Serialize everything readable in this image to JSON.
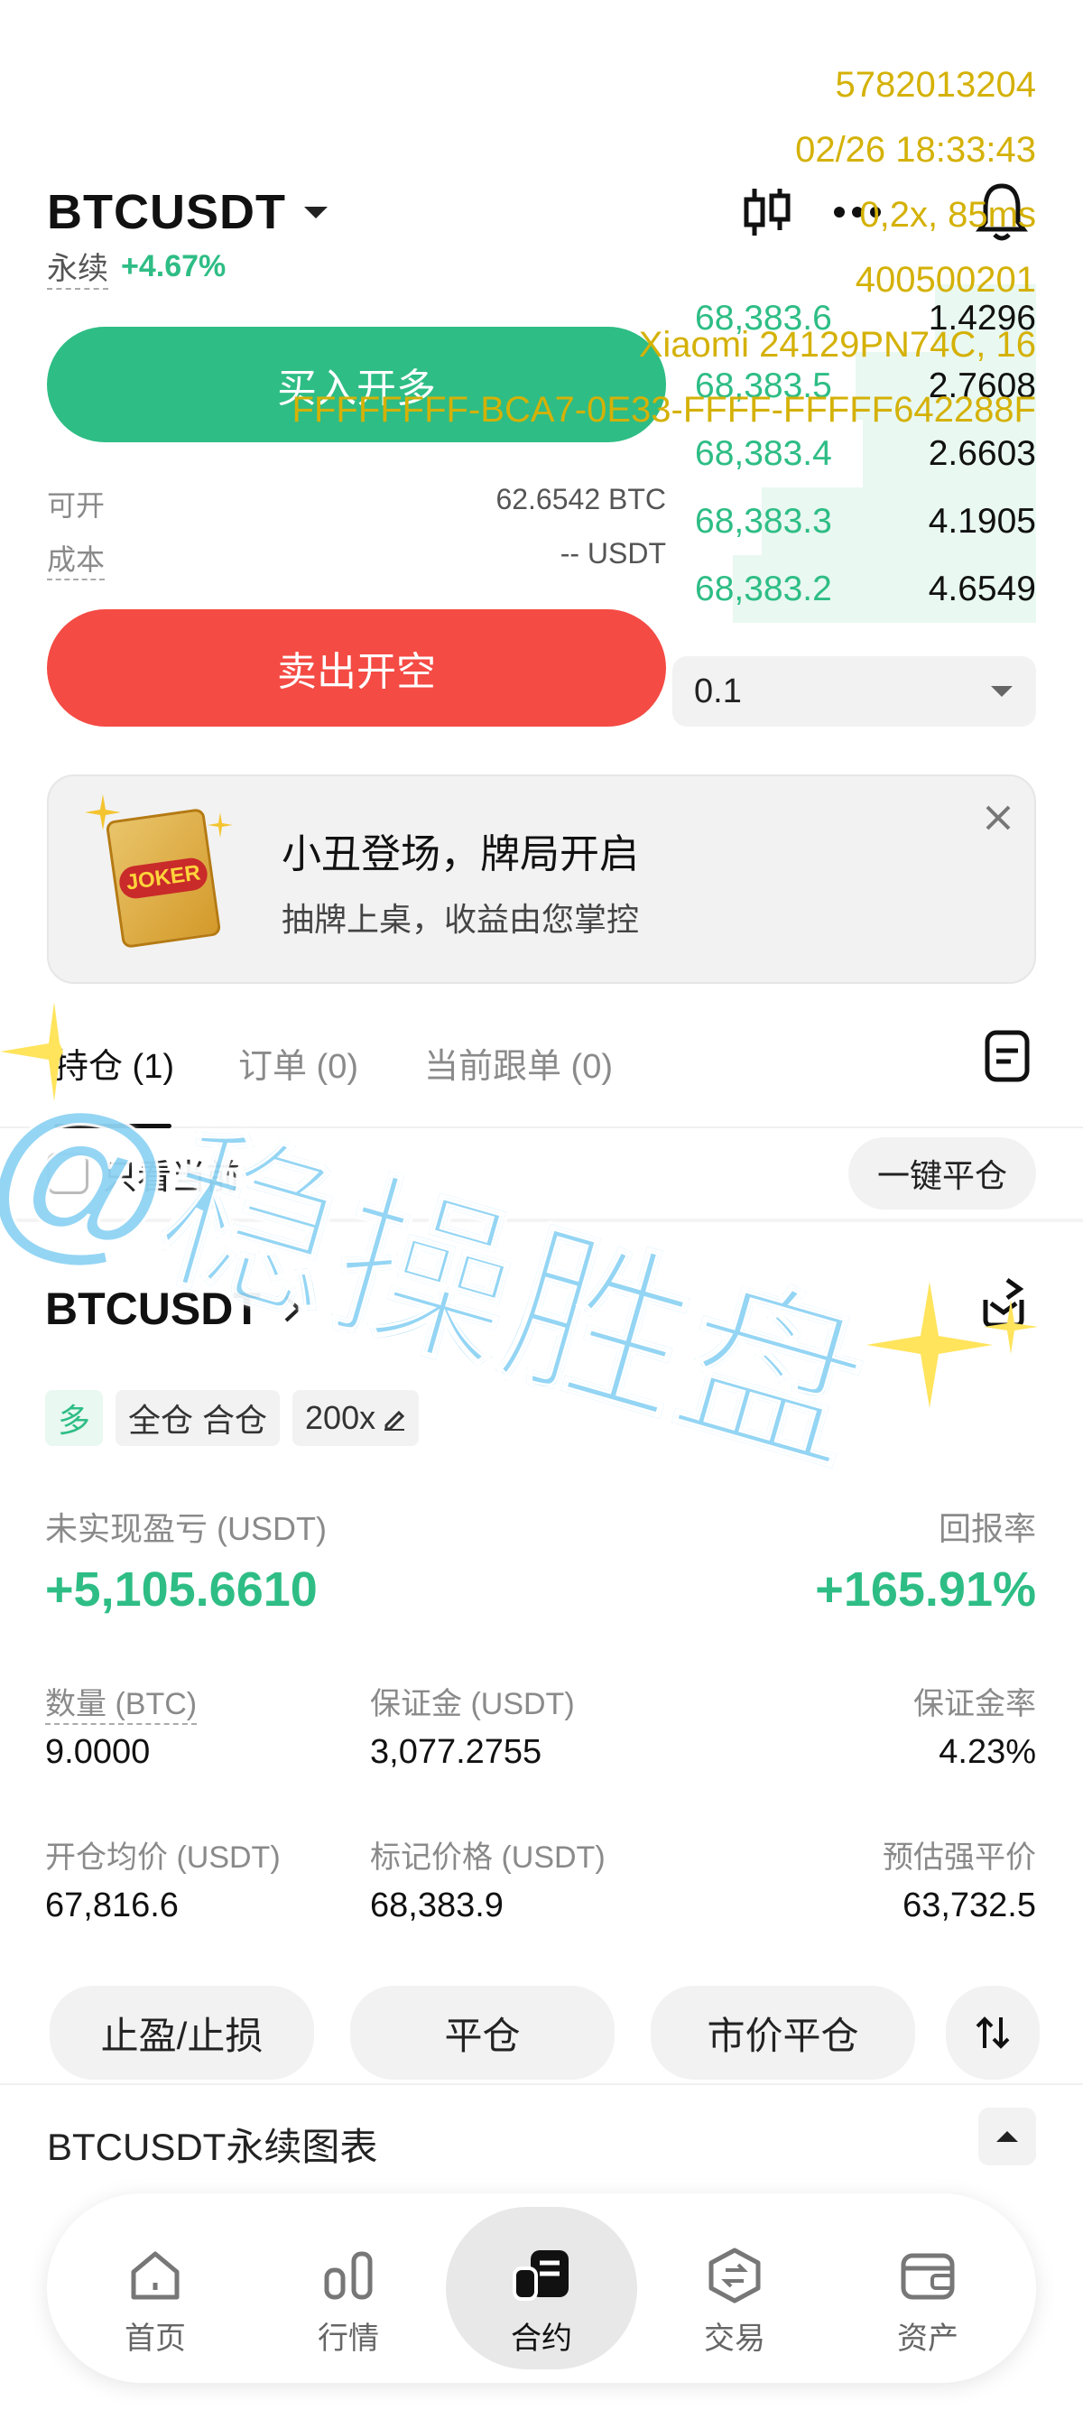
{
  "header": {
    "symbol": "BTCUSDT",
    "contract_type": "永续",
    "change": "+4.67%"
  },
  "watermark": {
    "line1": "5782013204",
    "line2": "02/26 18:33:43",
    "line3": "0,2x, 85ms",
    "line4": "400500201",
    "line5": "Xiaomi 24129PN74C, 16",
    "line6": "FFFFFFFF-BCA7-0E33-FFFF-FFFFF642288F"
  },
  "trade": {
    "buy_label": "买入开多",
    "sell_label": "卖出开空",
    "available_label": "可开",
    "available_value": "62.6542 BTC",
    "cost_label": "成本",
    "cost_value": "-- USDT",
    "qty_selector": "0.1"
  },
  "orderbook": {
    "rows": [
      {
        "price": "68,383.6",
        "qty": "1.4296",
        "depth": 0.28
      },
      {
        "price": "68,383.5",
        "qty": "2.7608",
        "depth": 0.5
      },
      {
        "price": "68,383.4",
        "qty": "2.6603",
        "depth": 0.48
      },
      {
        "price": "68,383.3",
        "qty": "4.1905",
        "depth": 0.76
      },
      {
        "price": "68,383.2",
        "qty": "4.6549",
        "depth": 0.84
      }
    ]
  },
  "banner": {
    "title": "小丑登场，牌局开启",
    "subtitle": "抽牌上桌，收益由您掌控",
    "image_text": "JOKER"
  },
  "tabs": {
    "positions": "持仓 (1)",
    "orders": "订单 (0)",
    "copy": "当前跟单 (0)"
  },
  "filter": {
    "only_current": "只看当前",
    "close_all": "一键平仓"
  },
  "overlay": {
    "text": "@稳操胜盘"
  },
  "position": {
    "symbol": "BTCUSDT",
    "side": "多",
    "margin_mode": "全仓 合仓",
    "leverage": "200x",
    "pnl_label": "未实现盈亏 (USDT)",
    "pnl_value": "+5,105.6610",
    "roe_label": "回报率",
    "roe_value": "+165.91%",
    "qty_label": "数量 (BTC)",
    "qty_value": "9.0000",
    "margin_label": "保证金 (USDT)",
    "margin_value": "3,077.2755",
    "margin_rate_label": "保证金率",
    "margin_rate_value": "4.23%",
    "entry_label": "开仓均价 (USDT)",
    "entry_value": "67,816.6",
    "mark_label": "标记价格 (USDT)",
    "mark_value": "68,383.9",
    "liq_label": "预估强平价",
    "liq_value": "63,732.5",
    "btn_tpsl": "止盈/止损",
    "btn_close": "平仓",
    "btn_market_close": "市价平仓"
  },
  "chart_bar": {
    "label": "BTCUSDT永续图表"
  },
  "nav": {
    "home": "首页",
    "market": "行情",
    "futures": "合约",
    "trade": "交易",
    "assets": "资产"
  },
  "colors": {
    "green": "#2ebd85",
    "red": "#f44b44",
    "watermark": "#d4b106",
    "overlay": "#8fd3f4"
  }
}
